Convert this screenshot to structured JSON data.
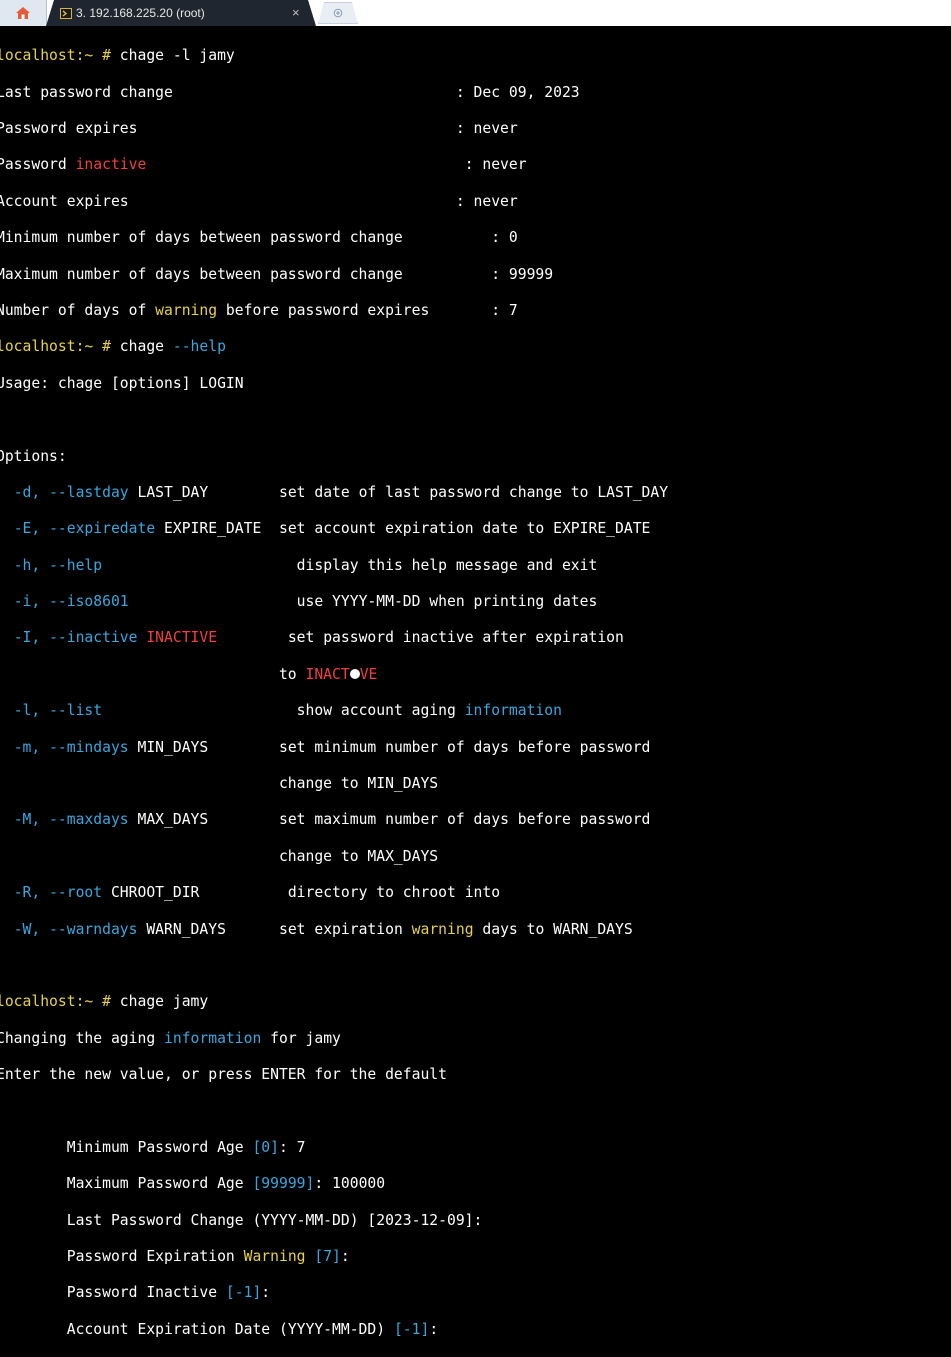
{
  "tabs": {
    "home_icon": "home-icon",
    "session_title": "3. 192.168.225.20 (root)",
    "close_glyph": "×",
    "new_tab_icon": "new-tab-icon"
  },
  "terminal": {
    "prompt": "localhost:~ #",
    "cmd1": " chage -l jamy",
    "chage_l": {
      "last_change_label": "Last password change",
      "last_change_value": ": Dec 09, 2023",
      "pw_expires_label": "Password expires",
      "pw_expires_value": ": never",
      "pw_inactive_pre": "Password ",
      "pw_inactive_word": "inactive",
      "pw_inactive_value": ": never",
      "acct_expires_label": "Account expires",
      "acct_expires_value": ": never",
      "min_days_label": "Minimum number of days between password change",
      "min_days_value": ": 0",
      "max_days_label": "Maximum number of days between password change",
      "max_days_value": ": 99999",
      "warn_pre": "Number of days of ",
      "warn_word": "warning",
      "warn_post": " before password expires",
      "warn_value": ": 7"
    },
    "cmd2_pre": " chage ",
    "cmd2_opt": "--help",
    "usage": "Usage: chage [options] LOGIN",
    "options_header": "Options:",
    "options": {
      "d_short": "-d, ",
      "d_long": "--lastday",
      "d_arg": " LAST_DAY",
      "d_desc": "set date of last password change to LAST_DAY",
      "E_short": "-E, ",
      "E_long": "--expiredate",
      "E_arg": " EXPIRE_DATE",
      "E_desc": "set account expiration date to EXPIRE_DATE",
      "h_short": "-h, ",
      "h_long": "--help",
      "h_desc": "display this help message and exit",
      "i_short": "-i, ",
      "i_long": "--iso8601",
      "i_desc": "use YYYY-MM-DD when printing dates",
      "I_short": "-I, ",
      "I_long": "--inactive",
      "I_arg": "INACTIVE",
      "I_desc": "set password inactive after expiration",
      "I_desc2_pre": "to ",
      "I_desc2_a": "INACT",
      "I_desc2_b": "VE",
      "l_short": "-l, ",
      "l_long": "--list",
      "l_desc_pre": "show account aging ",
      "l_desc_word": "information",
      "m_short": "-m, ",
      "m_long": "--mindays",
      "m_arg": " MIN_DAYS",
      "m_desc": "set minimum number of days before password",
      "m_desc2": "change to MIN_DAYS",
      "M_short": "-M, ",
      "M_long": "--maxdays",
      "M_arg": " MAX_DAYS",
      "M_desc": "set maximum number of days before password",
      "M_desc2": "change to MAX_DAYS",
      "R_short": "-R, ",
      "R_long": "--root",
      "R_arg": " CHROOT_DIR",
      "R_desc": "directory to chroot into",
      "W_short": "-W, ",
      "W_long": "--warndays",
      "W_arg": " WARN_DAYS",
      "W_desc_pre": "set expiration ",
      "W_desc_word": "warning",
      "W_desc_post": " days to WARN_DAYS"
    },
    "cmd3": " chage jamy",
    "changing_pre": "Changing the aging ",
    "changing_word": "information",
    "changing_post": " for jamy",
    "enter_line": "Enter the new value, or press ENTER for the default",
    "prompts": {
      "min_label": "Minimum Password Age ",
      "min_default": "[0]",
      "min_input": ": 7",
      "max_label": "Maximum Password Age ",
      "max_default": "[99999]",
      "max_input": ": 100000",
      "last_label": "Last Password Change (YYYY-MM-DD) [2023-12-09]:",
      "exp_label": "Password Expiration ",
      "exp_word": "Warning",
      "exp_default": " [7]",
      "exp_colon": ":",
      "inact_label": "Password Inactive ",
      "inact_default": "[-1]",
      "inact_colon": ":",
      "acct_label": "Account Expiration Date (YYYY-MM-DD) ",
      "acct_default": "[-1]",
      "acct_colon": ":"
    }
  }
}
